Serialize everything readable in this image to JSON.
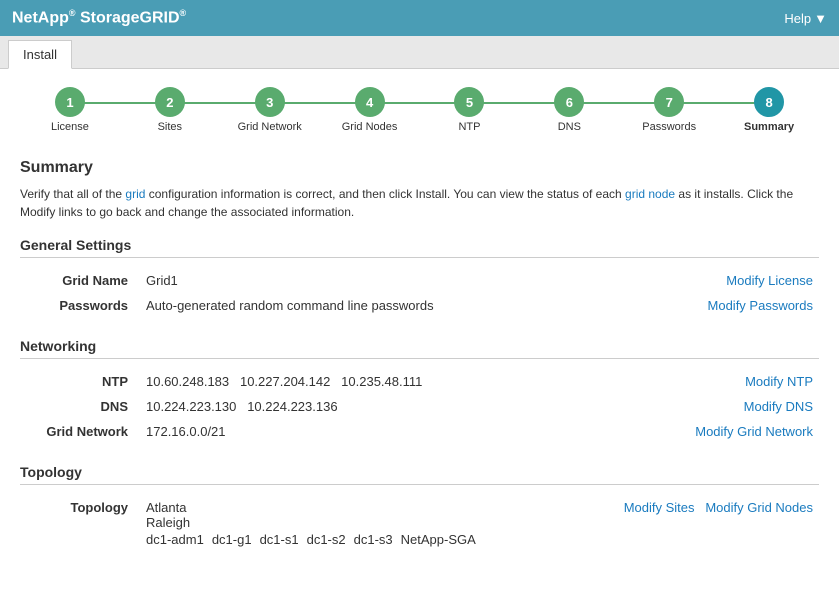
{
  "header": {
    "title": "NetApp",
    "title_sup1": "®",
    "title_product": " StorageGRID",
    "title_sup2": "®",
    "help_label": "Help"
  },
  "tabs": [
    {
      "label": "Install",
      "active": true
    }
  ],
  "steps": [
    {
      "number": "1",
      "label": "License",
      "active": false
    },
    {
      "number": "2",
      "label": "Sites",
      "active": false
    },
    {
      "number": "3",
      "label": "Grid Network",
      "active": false
    },
    {
      "number": "4",
      "label": "Grid Nodes",
      "active": false
    },
    {
      "number": "5",
      "label": "NTP",
      "active": false
    },
    {
      "number": "6",
      "label": "DNS",
      "active": false
    },
    {
      "number": "7",
      "label": "Passwords",
      "active": false
    },
    {
      "number": "8",
      "label": "Summary",
      "active": true
    }
  ],
  "page_title": "Summary",
  "description": "Verify that all of the grid configuration information is correct, and then click Install. You can view the status of each grid node as it installs. Click the Modify links to go back and change the associated information.",
  "sections": {
    "general_settings": {
      "header": "General Settings",
      "rows": [
        {
          "label": "Grid Name",
          "value": "Grid1",
          "action": "Modify License"
        },
        {
          "label": "Passwords",
          "value": "Auto-generated random command line passwords",
          "action": "Modify Passwords"
        }
      ]
    },
    "networking": {
      "header": "Networking",
      "rows": [
        {
          "label": "NTP",
          "value": "10.60.248.183   10.227.204.142   10.235.48.111",
          "action": "Modify NTP"
        },
        {
          "label": "DNS",
          "value": "10.224.223.130   10.224.223.136",
          "action": "Modify DNS"
        },
        {
          "label": "Grid Network",
          "value": "172.16.0.0/21",
          "action": "Modify Grid Network"
        }
      ]
    },
    "topology": {
      "header": "Topology",
      "label": "Topology",
      "sites": [
        {
          "name": "Atlanta",
          "nodes": []
        },
        {
          "name": "Raleigh",
          "nodes": [
            "dc1-adm1",
            "dc1-g1",
            "dc1-s1",
            "dc1-s2",
            "dc1-s3",
            "NetApp-SGA"
          ]
        }
      ],
      "actions": [
        "Modify Sites",
        "Modify Grid Nodes"
      ]
    }
  }
}
